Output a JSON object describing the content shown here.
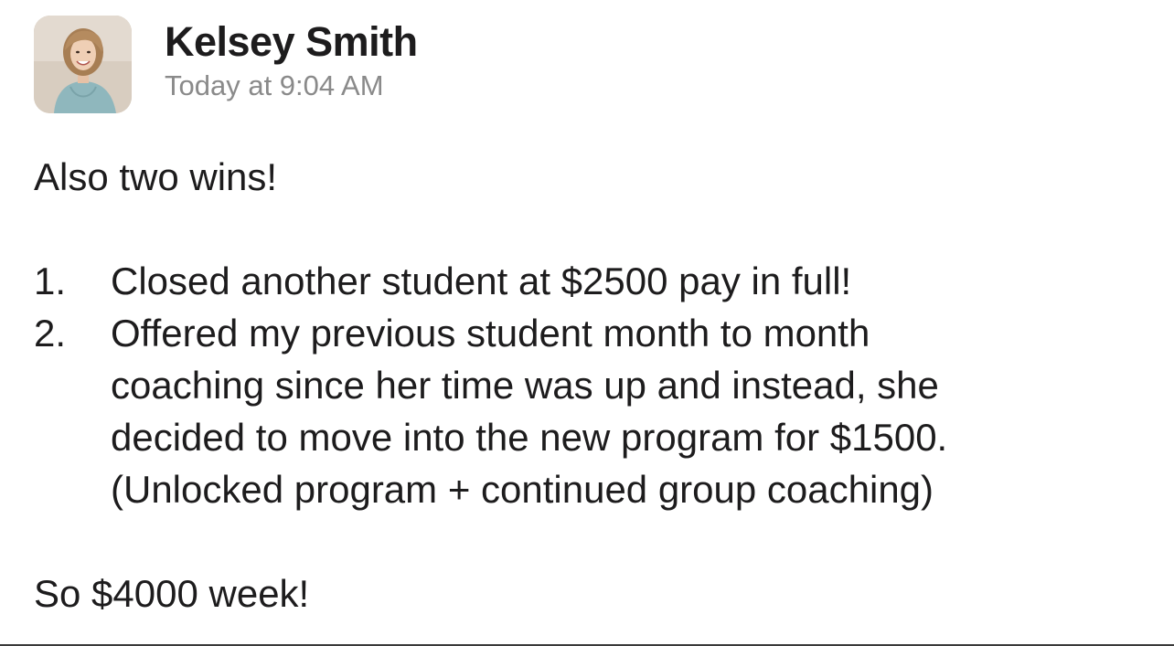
{
  "author": {
    "name": "Kelsey Smith",
    "avatar_icon": "profile-photo"
  },
  "timestamp": "Today at 9:04 AM",
  "message": {
    "intro": "Also two wins!",
    "items": [
      {
        "number": "1.",
        "lines": [
          "Closed another student at $2500 pay in full!"
        ]
      },
      {
        "number": "2.",
        "lines": [
          "Offered my previous student month to month",
          "coaching since her time was up and instead, she",
          "decided to move into the new program for $1500.",
          "(Unlocked program + continued group coaching)"
        ]
      }
    ],
    "closing": "So $4000 week!"
  },
  "colors": {
    "text": "#1d1c1d",
    "timestamp": "#8a8a8a",
    "background": "#ffffff"
  }
}
